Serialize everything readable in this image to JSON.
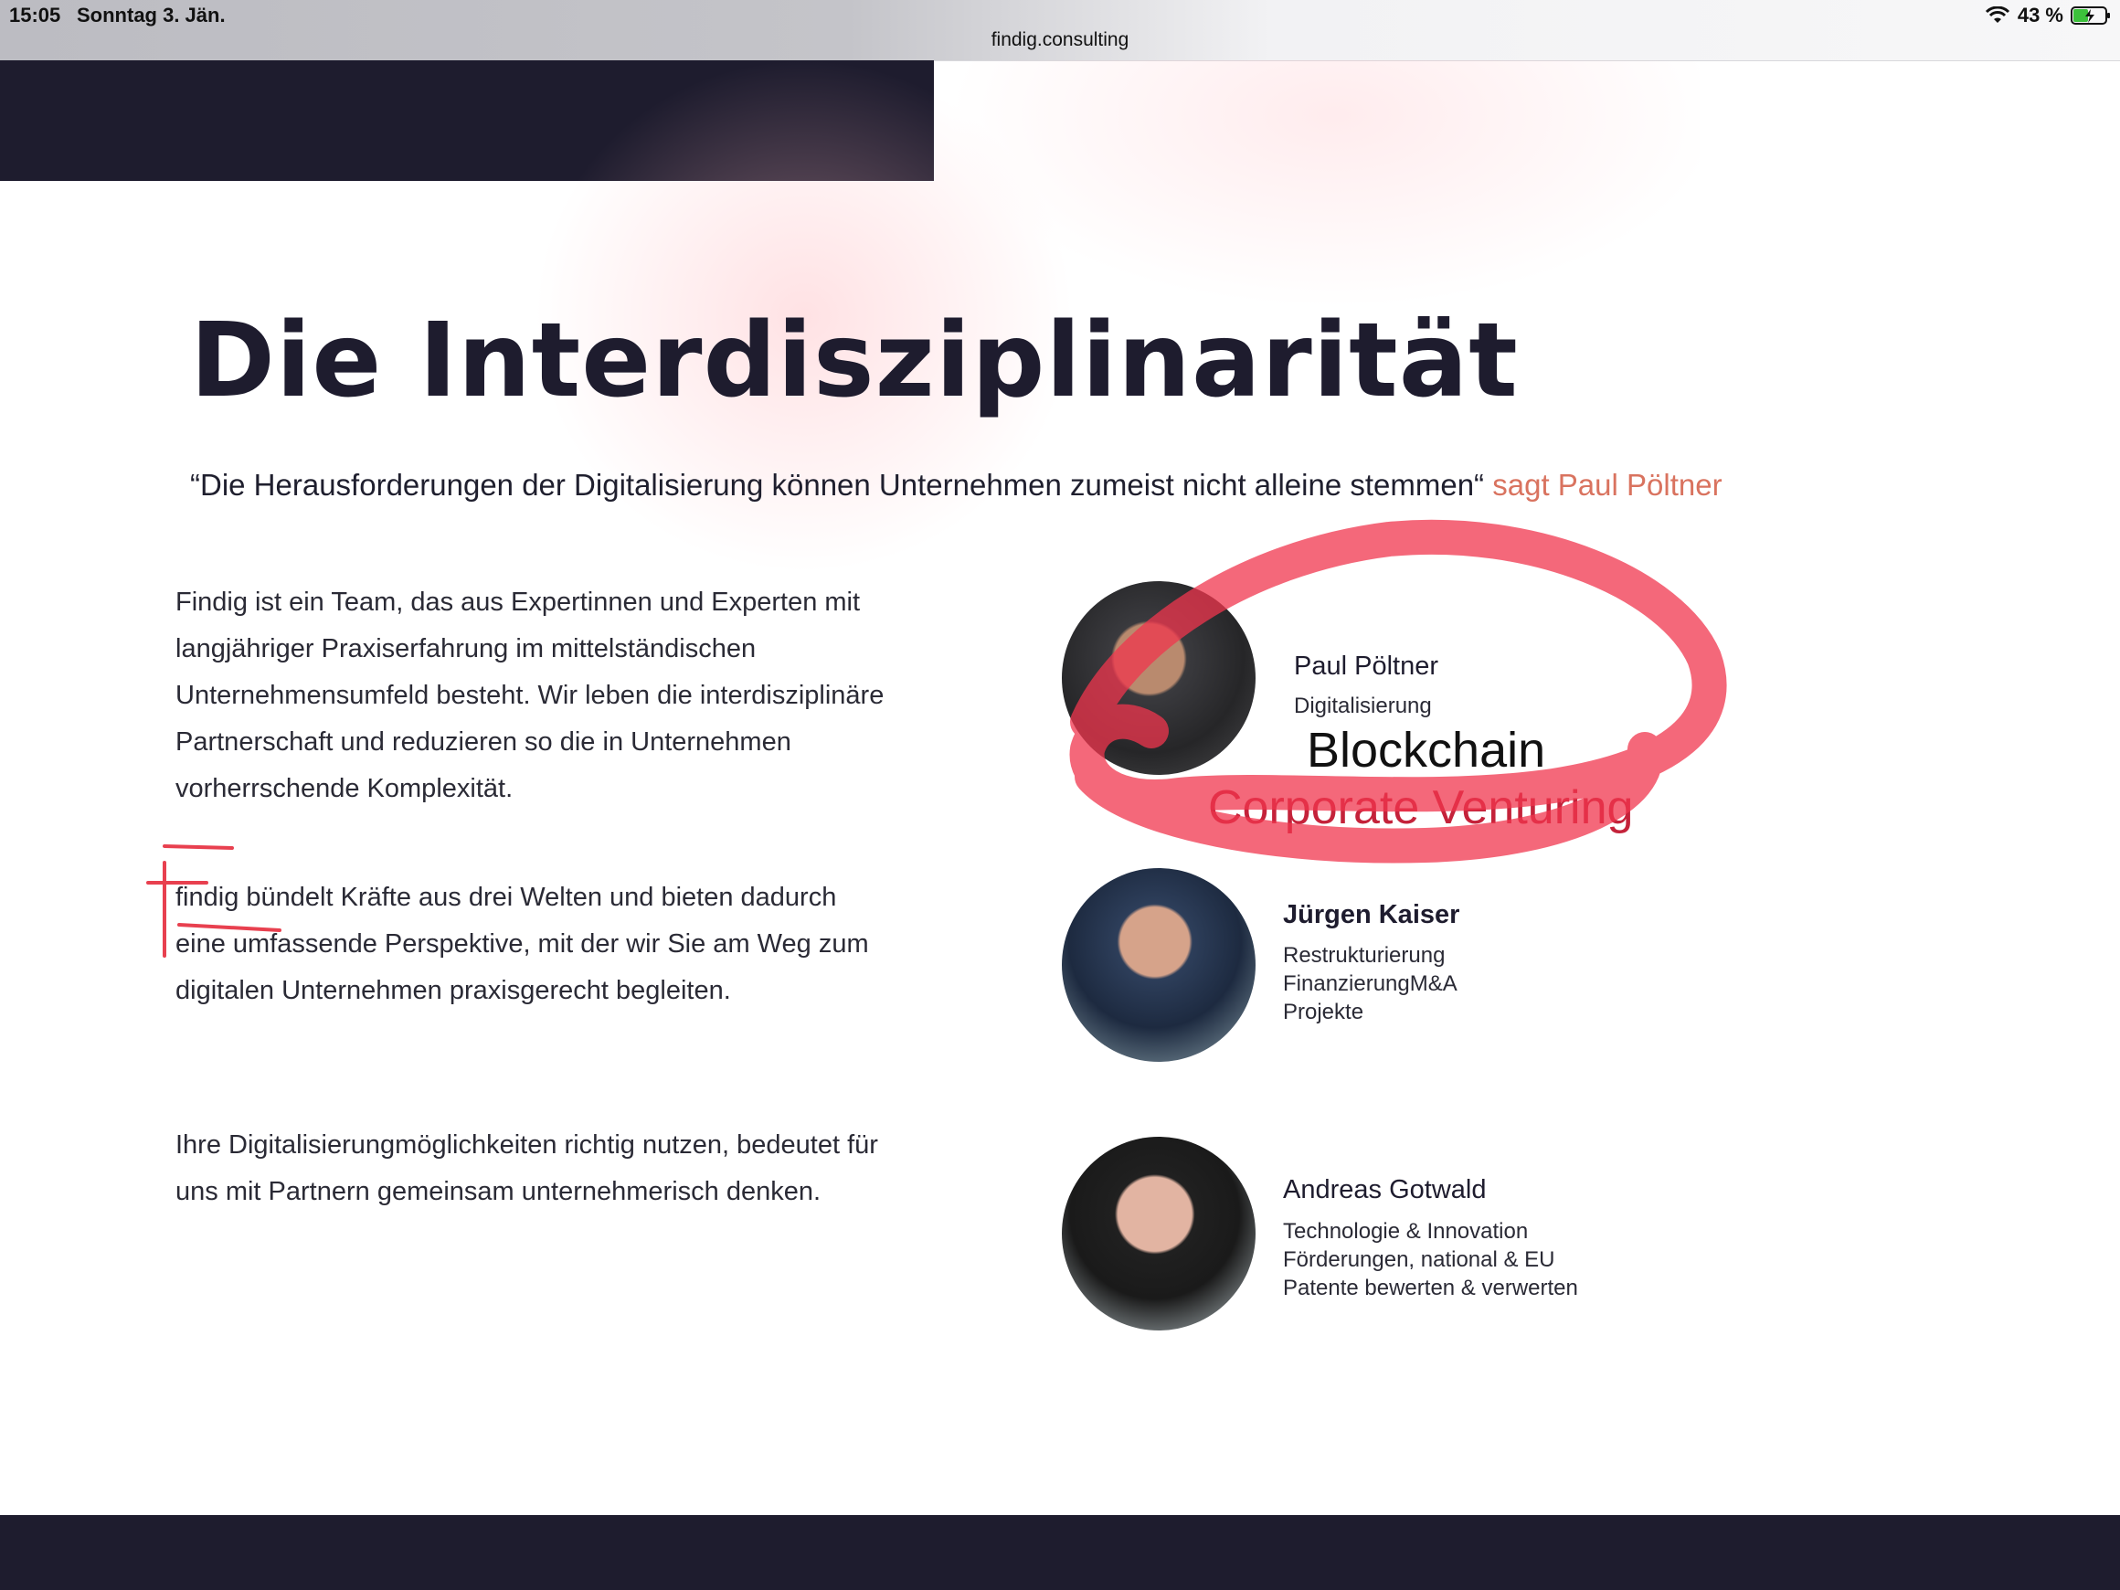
{
  "status_bar": {
    "time": "15:05",
    "date": "Sonntag 3. Jän.",
    "url": "findig.consulting",
    "battery": "43 %"
  },
  "page": {
    "title": "Die Interdisziplinarität",
    "quote_text": "“Die Herausforderungen der Digitalisierung können Unternehmen zumeist nicht alleine stemmen“",
    "quote_attribution": "sagt Paul Pöltner",
    "paragraphs": [
      "Findig ist ein Team, das aus Expertinnen und Experten mit langjähriger Praxiserfahrung im mittelständischen Unternehmensumfeld besteht. Wir leben die interdisziplinäre Partnerschaft und reduzieren so die in Unternehmen vorherrschende Komplexität.",
      "findig bündelt Kräfte aus drei Welten und bieten dadurch eine umfassende Perspektive, mit der wir Sie am Weg zum digitalen Unternehmen praxisgerecht begleiten.",
      "Ihre Digitalisierungmöglichkeiten richtig nutzen, bedeutet für uns mit Partnern gemeinsam unternehmerisch denken."
    ]
  },
  "team": [
    {
      "name": "Paul Pöltner",
      "roles": [
        "Digitalisierung"
      ],
      "extra": [
        "Blockchain",
        "Corporate Venturing"
      ]
    },
    {
      "name": "Jürgen Kaiser",
      "roles": [
        "Restrukturierung",
        "FinanzierungM&A",
        "Projekte"
      ]
    },
    {
      "name": "Andreas Gotwald",
      "roles": [
        "Technologie & Innovation",
        "Förderungen, national & EU",
        "Patente bewerten & verwerten"
      ]
    }
  ],
  "colors": {
    "dark": "#1e1c2e",
    "accent": "#d9735f",
    "annotation_red": "#f0354d"
  }
}
